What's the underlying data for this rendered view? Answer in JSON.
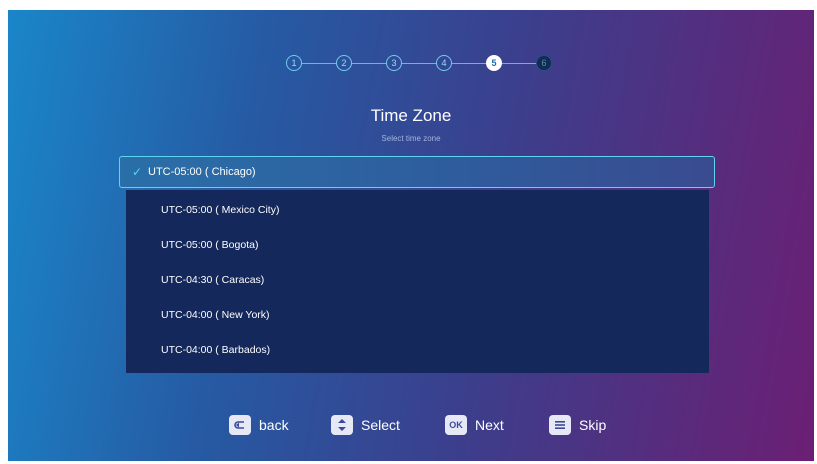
{
  "stepper": {
    "steps": [
      "1",
      "2",
      "3",
      "4",
      "5",
      "6"
    ],
    "active_index": 5
  },
  "header": {
    "title": "Time Zone",
    "subtitle": "Select time zone"
  },
  "timezone_list": {
    "selected": "UTC-05:00 ( Chicago)",
    "items": [
      "UTC-05:00 ( Mexico City)",
      "UTC-05:00 ( Bogota)",
      "UTC-04:30 ( Caracas)",
      "UTC-04:00 ( New York)",
      "UTC-04:00 ( Barbados)"
    ]
  },
  "footer": {
    "back_label": "back",
    "select_label": "Select",
    "ok_key": "OK",
    "next_label": "Next",
    "skip_label": "Skip"
  },
  "colors": {
    "accent": "#5fd3f0",
    "list_bg": "#15285c",
    "active_step": "#ffffff"
  }
}
